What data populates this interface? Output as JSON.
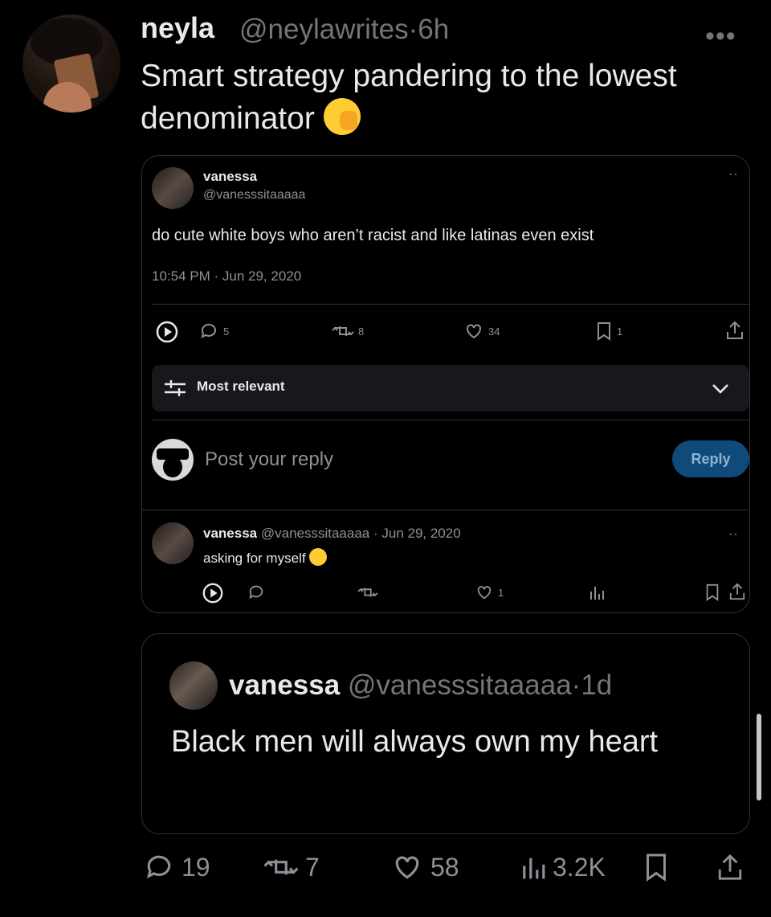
{
  "tweet": {
    "author_name": "neyla",
    "author_handle": "@neylawrites",
    "separator": "·",
    "age": "6h",
    "text": "Smart strategy pandering to the lowest denominator",
    "emoji_icon": "face-with-hand-over-mouth-icon"
  },
  "screenshot": {
    "author_name": "vanessa",
    "author_handle": "@vanesssitaaaaa",
    "text": "do cute white boys who aren’t racist and like latinas even exist",
    "timestamp": "10:54 PM · Jun 29, 2020",
    "stats": {
      "replies": "5",
      "reposts": "8",
      "likes": "34",
      "bookmarks": "1"
    },
    "sort_label": "Most relevant",
    "reply_placeholder": "Post your reply",
    "reply_button": "Reply",
    "reply": {
      "author_name": "vanessa",
      "meta": "@vanesssitaaaaa · Jun 29, 2020",
      "text": "asking for myself",
      "likes": "1"
    }
  },
  "quote": {
    "author_name": "vanessa",
    "author_handle": "@vanesssitaaaaa",
    "separator": "·",
    "age": "1d",
    "text": "Black men will always own my heart"
  },
  "actions": {
    "replies": "19",
    "reposts": "7",
    "likes": "58",
    "views": "3.2K"
  }
}
